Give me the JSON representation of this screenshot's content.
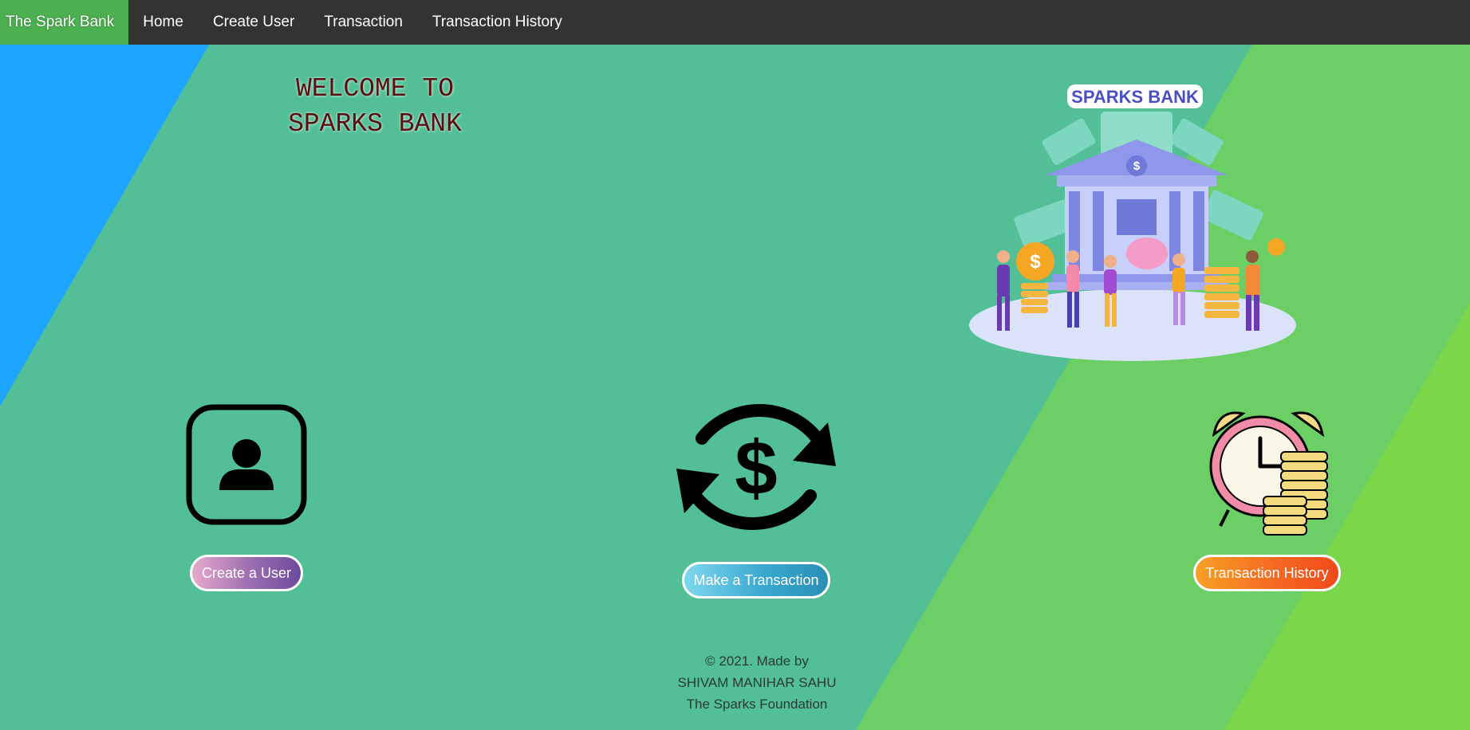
{
  "navbar": {
    "brand": "The Spark Bank",
    "links": [
      "Home",
      "Create User",
      "Transaction",
      "Transaction History"
    ]
  },
  "hero": {
    "welcome_line1": "WELCOME TO",
    "welcome_line2": "SPARKS BANK",
    "illustration_title": "SPARKS BANK"
  },
  "actions": {
    "create_user": {
      "label": "Create a User",
      "icon": "user-avatar-icon"
    },
    "make_transaction": {
      "label": "Make a Transaction",
      "icon": "money-exchange-icon"
    },
    "transaction_history": {
      "label": "Transaction History",
      "icon": "alarm-clock-coins-icon"
    }
  },
  "footer": {
    "line1": "© 2021. Made by",
    "line2": "SHIVAM MANIHAR SAHU",
    "line3": "The Sparks Foundation"
  },
  "colors": {
    "navbar_bg": "#333333",
    "brand_bg": "#4caf50",
    "page_teal": "#52bf96",
    "left_blue": "#1ea5ff",
    "right_green": "#6ccf65",
    "far_green": "#7ad649"
  }
}
